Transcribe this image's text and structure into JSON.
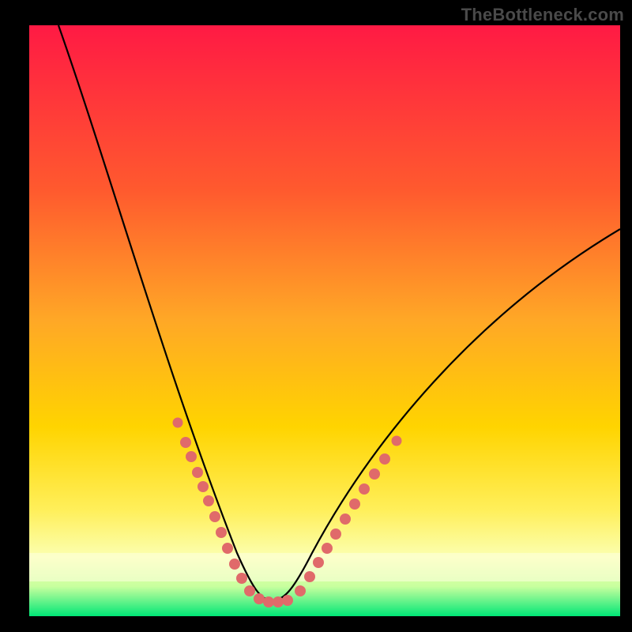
{
  "watermark": {
    "text": "TheBottleneck.com"
  },
  "chart_data": {
    "type": "line",
    "title": "",
    "xlabel": "",
    "ylabel": "",
    "xlim": [
      0,
      100
    ],
    "ylim": [
      0,
      100
    ],
    "grid": false,
    "legend": false,
    "background_gradient": {
      "top": "#ff1a44",
      "mid1": "#ff7a2a",
      "mid2": "#ffd400",
      "mid3": "#fff56b",
      "bottom_band": "#f6ffd0",
      "bottom": "#00e676"
    },
    "series": [
      {
        "name": "bottleneck-curve",
        "color": "#000000",
        "x": [
          5,
          8,
          11,
          14,
          17,
          20,
          23,
          26,
          28,
          30,
          32,
          34,
          36,
          38,
          40,
          44,
          48,
          52,
          56,
          60,
          65,
          70,
          75,
          80,
          85,
          90,
          95,
          100
        ],
        "y": [
          100,
          92,
          84,
          76,
          68,
          60,
          52,
          44,
          38,
          32,
          26,
          20,
          14,
          8,
          3,
          3,
          8,
          14,
          20,
          26,
          33,
          40,
          47,
          53,
          58,
          62,
          65,
          67
        ]
      },
      {
        "name": "dots-left",
        "color": "#e57373",
        "type": "scatter",
        "x": [
          26,
          27,
          28,
          28.5,
          29,
          30,
          31,
          32,
          33,
          34,
          35,
          36,
          37
        ],
        "y": [
          40,
          37,
          34,
          32,
          30,
          27,
          24,
          21,
          18,
          15,
          12,
          9,
          6
        ]
      },
      {
        "name": "dots-right",
        "color": "#e57373",
        "type": "scatter",
        "x": [
          44,
          46,
          48,
          49,
          50,
          52,
          53,
          54,
          55,
          56,
          57,
          58,
          59
        ],
        "y": [
          5,
          8,
          11,
          13,
          15,
          19,
          21,
          23,
          25,
          27,
          29,
          31,
          33
        ]
      },
      {
        "name": "dots-bottom",
        "color": "#e57373",
        "type": "scatter",
        "x": [
          38,
          39,
          40,
          41,
          42,
          43
        ],
        "y": [
          3,
          2.5,
          2.5,
          2.5,
          2.5,
          3
        ]
      }
    ]
  }
}
